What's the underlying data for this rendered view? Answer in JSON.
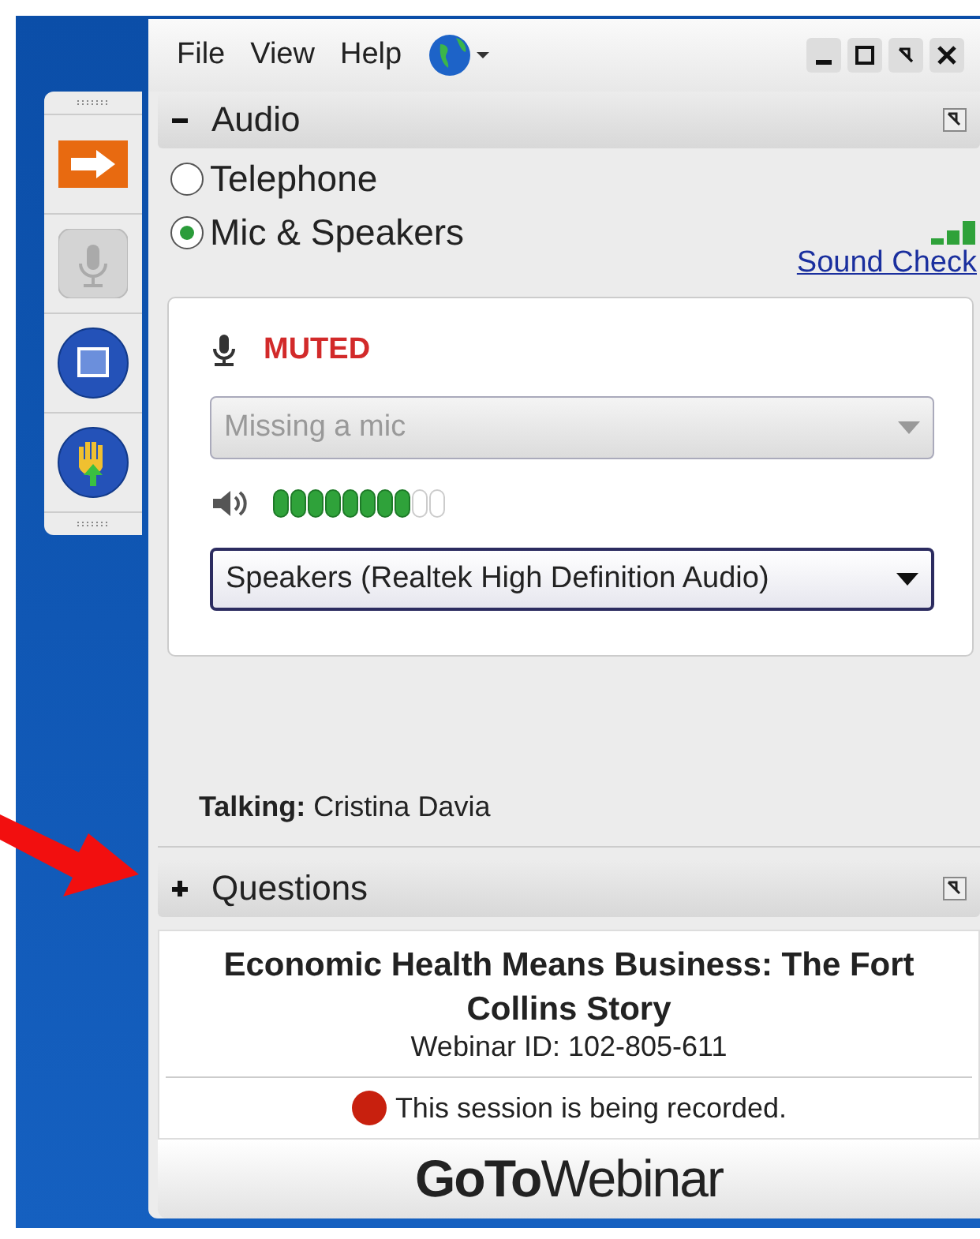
{
  "menu": [
    {
      "label": "File"
    },
    {
      "label": "View"
    },
    {
      "label": "Help"
    }
  ],
  "audio": {
    "title": "Audio",
    "expanded": true,
    "options": [
      {
        "label": "Telephone",
        "selected": false
      },
      {
        "label": "Mic & Speakers",
        "selected": true
      }
    ],
    "sound_check": "Sound Check",
    "mic_status": "MUTED",
    "mic_select": {
      "value": "Missing a mic",
      "disabled": true
    },
    "speaker_meter": {
      "level": 0.8
    },
    "speaker_select": {
      "value": "Speakers (Realtek High Definition Audio)",
      "disabled": false
    },
    "talking": "**Talking:** Cristina Davia"
  },
  "questions": {
    "title": "Questions",
    "expanded": false
  },
  "session": {
    "title": "Economic Health Means Business: The Fort Collins Story",
    "webinar_id": "Webinar ID: 102-805-611",
    "recording": true,
    "recording_text": "This session is being recorded."
  },
  "logo": "**GoTo**Webinar"
}
